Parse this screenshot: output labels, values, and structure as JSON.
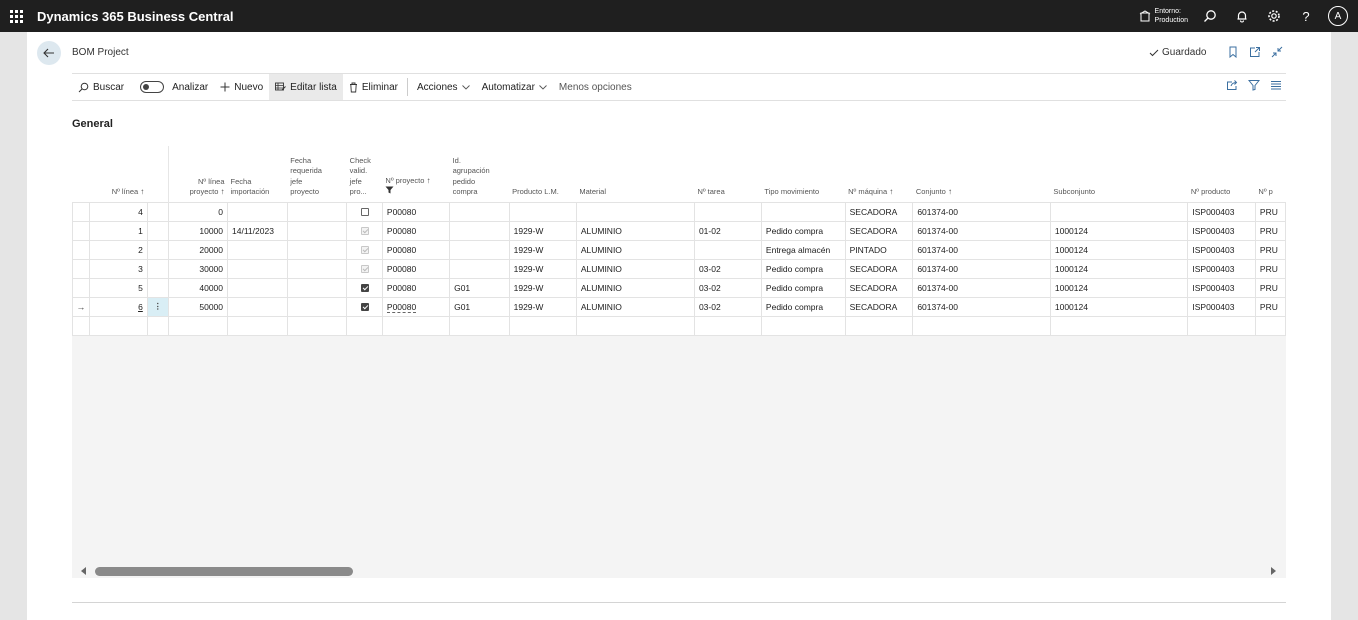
{
  "app": {
    "title": "Dynamics 365 Business Central",
    "env_line1": "Entorno:",
    "env_line2": "Production",
    "avatar": "A"
  },
  "page": {
    "title": "BOM Project",
    "saved": "Guardado",
    "section": "General"
  },
  "actions": {
    "search": "Buscar",
    "analyze": "Analizar",
    "new": "Nuevo",
    "edit_list": "Editar lista",
    "delete": "Eliminar",
    "actions": "Acciones",
    "automate": "Automatizar",
    "fewer_options": "Menos opciones"
  },
  "columns": {
    "line_no": "Nº línea",
    "project_line_1": "Nº línea",
    "project_line_2": "proyecto",
    "import_date_1": "Fecha",
    "import_date_2": "importación",
    "req_date_1": "Fecha",
    "req_date_2": "requerida",
    "req_date_3": "jefe",
    "req_date_4": "proyecto",
    "check_1": "Check",
    "check_2": "valid.",
    "check_3": "jefe",
    "check_4": "pro...",
    "project_no": "Nº proyecto",
    "group_1": "Id.",
    "group_2": "agrupación",
    "group_3": "pedido",
    "group_4": "compra",
    "product_lm": "Producto L.M.",
    "material": "Material",
    "task_no": "Nº tarea",
    "movement_type": "Tipo movimiento",
    "machine_no": "Nº máquina",
    "assembly": "Conjunto",
    "subassembly": "Subconjunto",
    "product_no": "Nº producto",
    "next_col": "Nº p"
  },
  "rows": [
    {
      "line": "4",
      "proj_line": "0",
      "import_date": "",
      "req_date": "",
      "check": "off",
      "project": "P00080",
      "group": "",
      "product_lm": "",
      "material": "",
      "task": "",
      "movement": "",
      "machine": "SECADORA",
      "assembly": "601374-00",
      "sub": "",
      "product": "ISP000403",
      "next": "PRU"
    },
    {
      "line": "1",
      "proj_line": "10000",
      "import_date": "14/11/2023",
      "req_date": "",
      "check": "dis",
      "project": "P00080",
      "group": "",
      "product_lm": "1929-W",
      "material": "ALUMINIO",
      "task": "01-02",
      "movement": "Pedido compra",
      "machine": "SECADORA",
      "assembly": "601374-00",
      "sub": "1000124",
      "product": "ISP000403",
      "next": "PRU"
    },
    {
      "line": "2",
      "proj_line": "20000",
      "import_date": "",
      "req_date": "",
      "check": "dis",
      "project": "P00080",
      "group": "",
      "product_lm": "1929-W",
      "material": "ALUMINIO",
      "task": "",
      "movement": "Entrega almacén",
      "machine": "PINTADO",
      "assembly": "601374-00",
      "sub": "1000124",
      "product": "ISP000403",
      "next": "PRU"
    },
    {
      "line": "3",
      "proj_line": "30000",
      "import_date": "",
      "req_date": "",
      "check": "dis",
      "project": "P00080",
      "group": "",
      "product_lm": "1929-W",
      "material": "ALUMINIO",
      "task": "03-02",
      "movement": "Pedido compra",
      "machine": "SECADORA",
      "assembly": "601374-00",
      "sub": "1000124",
      "product": "ISP000403",
      "next": "PRU"
    },
    {
      "line": "5",
      "proj_line": "40000",
      "import_date": "",
      "req_date": "",
      "check": "on",
      "project": "P00080",
      "group": "G01",
      "product_lm": "1929-W",
      "material": "ALUMINIO",
      "task": "03-02",
      "movement": "Pedido compra",
      "machine": "SECADORA",
      "assembly": "601374-00",
      "sub": "1000124",
      "product": "ISP000403",
      "next": "PRU"
    },
    {
      "line": "6",
      "proj_line": "50000",
      "import_date": "",
      "req_date": "",
      "check": "on",
      "project": "P00080",
      "group": "G01",
      "product_lm": "1929-W",
      "material": "ALUMINIO",
      "task": "03-02",
      "movement": "Pedido compra",
      "machine": "SECADORA",
      "assembly": "601374-00",
      "sub": "1000124",
      "product": "ISP000403",
      "next": "PRU"
    }
  ]
}
